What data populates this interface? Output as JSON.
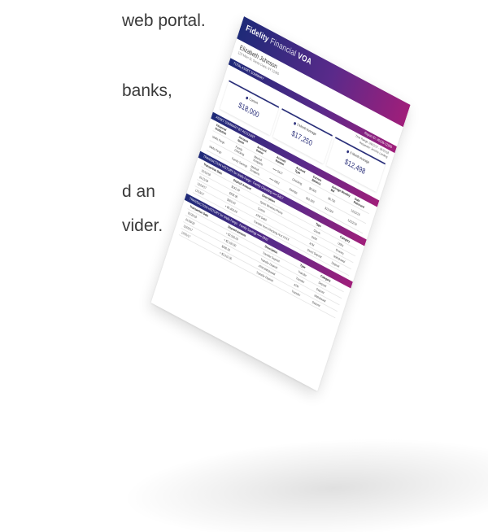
{
  "side_text": {
    "line1": "web portal.",
    "line2": "banks,",
    "line3": "d an",
    "line4": "vider."
  },
  "report": {
    "brand_bold": "Fidelity",
    "brand_thin": "Financial",
    "brand_suffix": "VOA",
    "client_name": "Elizabeth Johnson",
    "client_address": "123 Main St, Santa Clara, NY 12345",
    "summary_bar": "TOTAL ASSET SUMMARY",
    "report_id": "Report ID: V0128-12345",
    "time_range": "Time Range: 04/01/17 - 06/01/18",
    "requester": "Requestor: Jerome Lending",
    "cards": [
      {
        "label": "Current",
        "value": "$18,000"
      },
      {
        "label": "3 Month Average",
        "value": "$17,250"
      },
      {
        "label": "6 Month Average",
        "value": "$12,498"
      }
    ],
    "accounts_bar": "ASSET SUMMARY BY ACCOUNT",
    "accounts_headers": [
      "Financial Institution",
      "Account Name",
      "Account Owner",
      "Account Number",
      "Account Type",
      "Current Balance",
      "Average Monthly Bal",
      "Date Retrieved"
    ],
    "accounts_rows": [
      [
        "Wells Fargo",
        "Family Checking",
        "Mitchell Tompkins",
        "••••• 5417",
        "Checking",
        "$6,500",
        "$6,750",
        "12/22/16"
      ],
      [
        "Wells Fargo",
        "Family Savings",
        "Mitchell Tompkins",
        "••••• 0902",
        "Savings",
        "$10,500",
        "$13,500",
        "12/22/16"
      ]
    ],
    "tx1_bar": "TRANSACTION HISTORY for Wells Fargo · Family Checking ••••• 5417",
    "tx1_headers": [
      "Transaction Date",
      "Deposit Amount",
      "Description",
      "Type",
      "Category"
    ],
    "tx1_rows": [
      [
        "01/15/18",
        "$142.39",
        "Sprint Wireless Phone",
        "Check",
        "Utility"
      ],
      [
        "01/11/18",
        "$358.06",
        "Costco",
        "Debit",
        "Grocery"
      ],
      [
        "12/24/17",
        "$300.00",
        "ATM Debit",
        "ATM",
        "Withdrawal"
      ],
      [
        "12/19/17",
        "+ $5,400.00",
        "Transfer from Checking Acct XXXX",
        "Direct Deposit",
        "Deposit"
      ]
    ],
    "tx2_bar": "TRANSACTION HISTORY for Wells Fargo · Family Savings ••••• 0902",
    "tx2_headers": [
      "Transaction Date",
      "Deposit Amount",
      "Description",
      "Type",
      "Category"
    ],
    "tx2_rows": [
      [
        "01/20/18",
        "+ $2,500.00",
        "Transfer Deposit",
        "Transfer",
        "Deposit"
      ],
      [
        "01/09/18",
        "+ $2,100.00",
        "Transfer Deposit",
        "Transfer",
        "Deposit"
      ],
      [
        "12/03/17",
        "$300.00",
        "ATM Withdrawal",
        "ATM",
        "Withdrawal"
      ],
      [
        "12/01/17",
        "+ $2,010.00",
        "Transfer Deposit",
        "Transfer",
        "Deposit"
      ]
    ]
  }
}
